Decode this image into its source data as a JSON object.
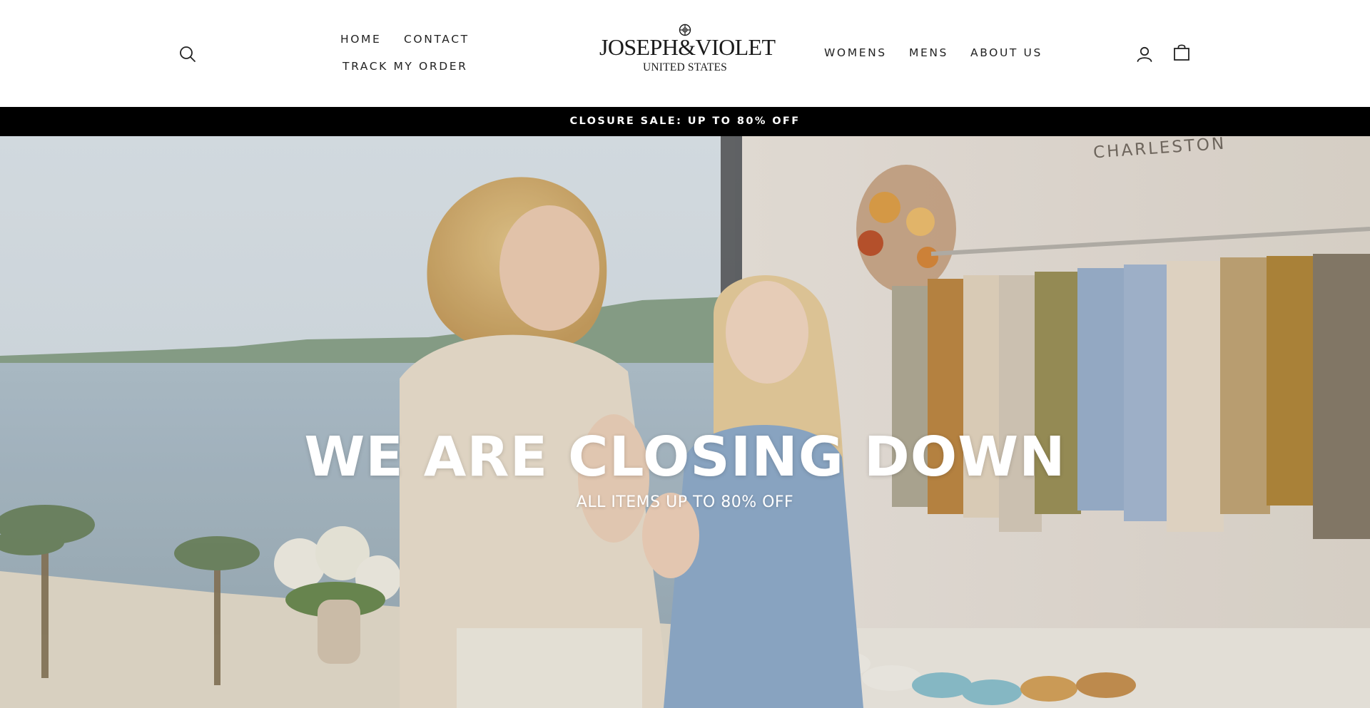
{
  "header": {
    "search_icon": "search-icon",
    "nav_left": [
      {
        "label": "HOME"
      },
      {
        "label": "CONTACT"
      },
      {
        "label": "TRACK MY ORDER"
      }
    ],
    "logo": {
      "name": "JOSEPH&VIOLET",
      "region": "UNITED STATES"
    },
    "nav_right": [
      {
        "label": "WOMENS"
      },
      {
        "label": "MENS"
      },
      {
        "label": "ABOUT US"
      }
    ],
    "account_icon": "user-icon",
    "cart_icon": "bag-icon"
  },
  "announcement": {
    "text": "CLOSURE SALE: UP TO 80% OFF",
    "background": "#000000",
    "color": "#ffffff"
  },
  "hero": {
    "title": "WE ARE CLOSING DOWN",
    "subtitle": "ALL ITEMS UP TO 80% OFF",
    "store_sign": "CHARLESTON"
  }
}
